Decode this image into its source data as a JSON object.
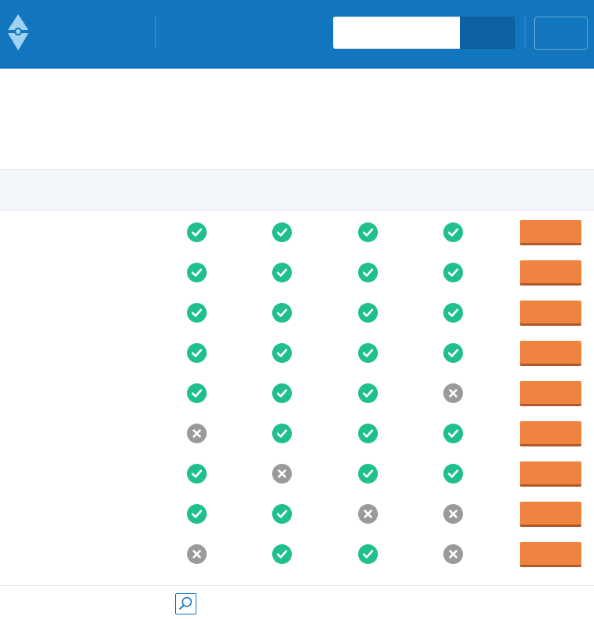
{
  "header": {
    "logo_icon": "compass-logo-icon",
    "search": {
      "placeholder": "",
      "value": ""
    },
    "search_button_icon": "none",
    "menu_button_icon": "none"
  },
  "colors": {
    "header_bg": "#1276be",
    "check": "#20bf8e",
    "cross": "#9a9a9a",
    "action": "#ee843f"
  },
  "table": {
    "columns": 4,
    "rows": [
      {
        "cells": [
          "yes",
          "yes",
          "yes",
          "yes"
        ]
      },
      {
        "cells": [
          "yes",
          "yes",
          "yes",
          "yes"
        ]
      },
      {
        "cells": [
          "yes",
          "yes",
          "yes",
          "yes"
        ]
      },
      {
        "cells": [
          "yes",
          "yes",
          "yes",
          "yes"
        ]
      },
      {
        "cells": [
          "yes",
          "yes",
          "yes",
          "no"
        ]
      },
      {
        "cells": [
          "no",
          "yes",
          "yes",
          "yes"
        ]
      },
      {
        "cells": [
          "yes",
          "no",
          "yes",
          "yes"
        ]
      },
      {
        "cells": [
          "yes",
          "yes",
          "no",
          "no"
        ]
      },
      {
        "cells": [
          "no",
          "yes",
          "yes",
          "no"
        ]
      }
    ]
  },
  "footer": {
    "icon": "zoom-icon"
  }
}
